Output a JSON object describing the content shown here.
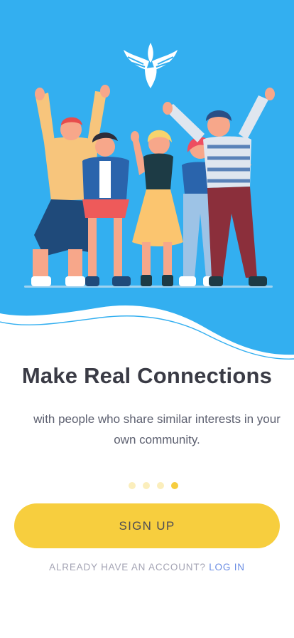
{
  "hero": {
    "illustration": "group-of-friends-illustration",
    "logo_icon": "bird-logo-icon",
    "colors": {
      "sky": "#33aff0",
      "wave_line": "#33aff0"
    }
  },
  "content": {
    "title": "Make Real Connections",
    "subtitle_line1": "with people who share similar interests in your",
    "subtitle_line2": "own community."
  },
  "pager": {
    "total": 4,
    "active_index": 3,
    "colors": {
      "inactive": "#fbeebc",
      "active": "#f6cd3f"
    }
  },
  "actions": {
    "signup_label": "SIGN UP",
    "signup_color": "#f7ce3e",
    "login_prompt": "ALREADY HAVE AN ACCOUNT?",
    "login_label": "LOG IN",
    "login_color": "#6b8de3"
  }
}
